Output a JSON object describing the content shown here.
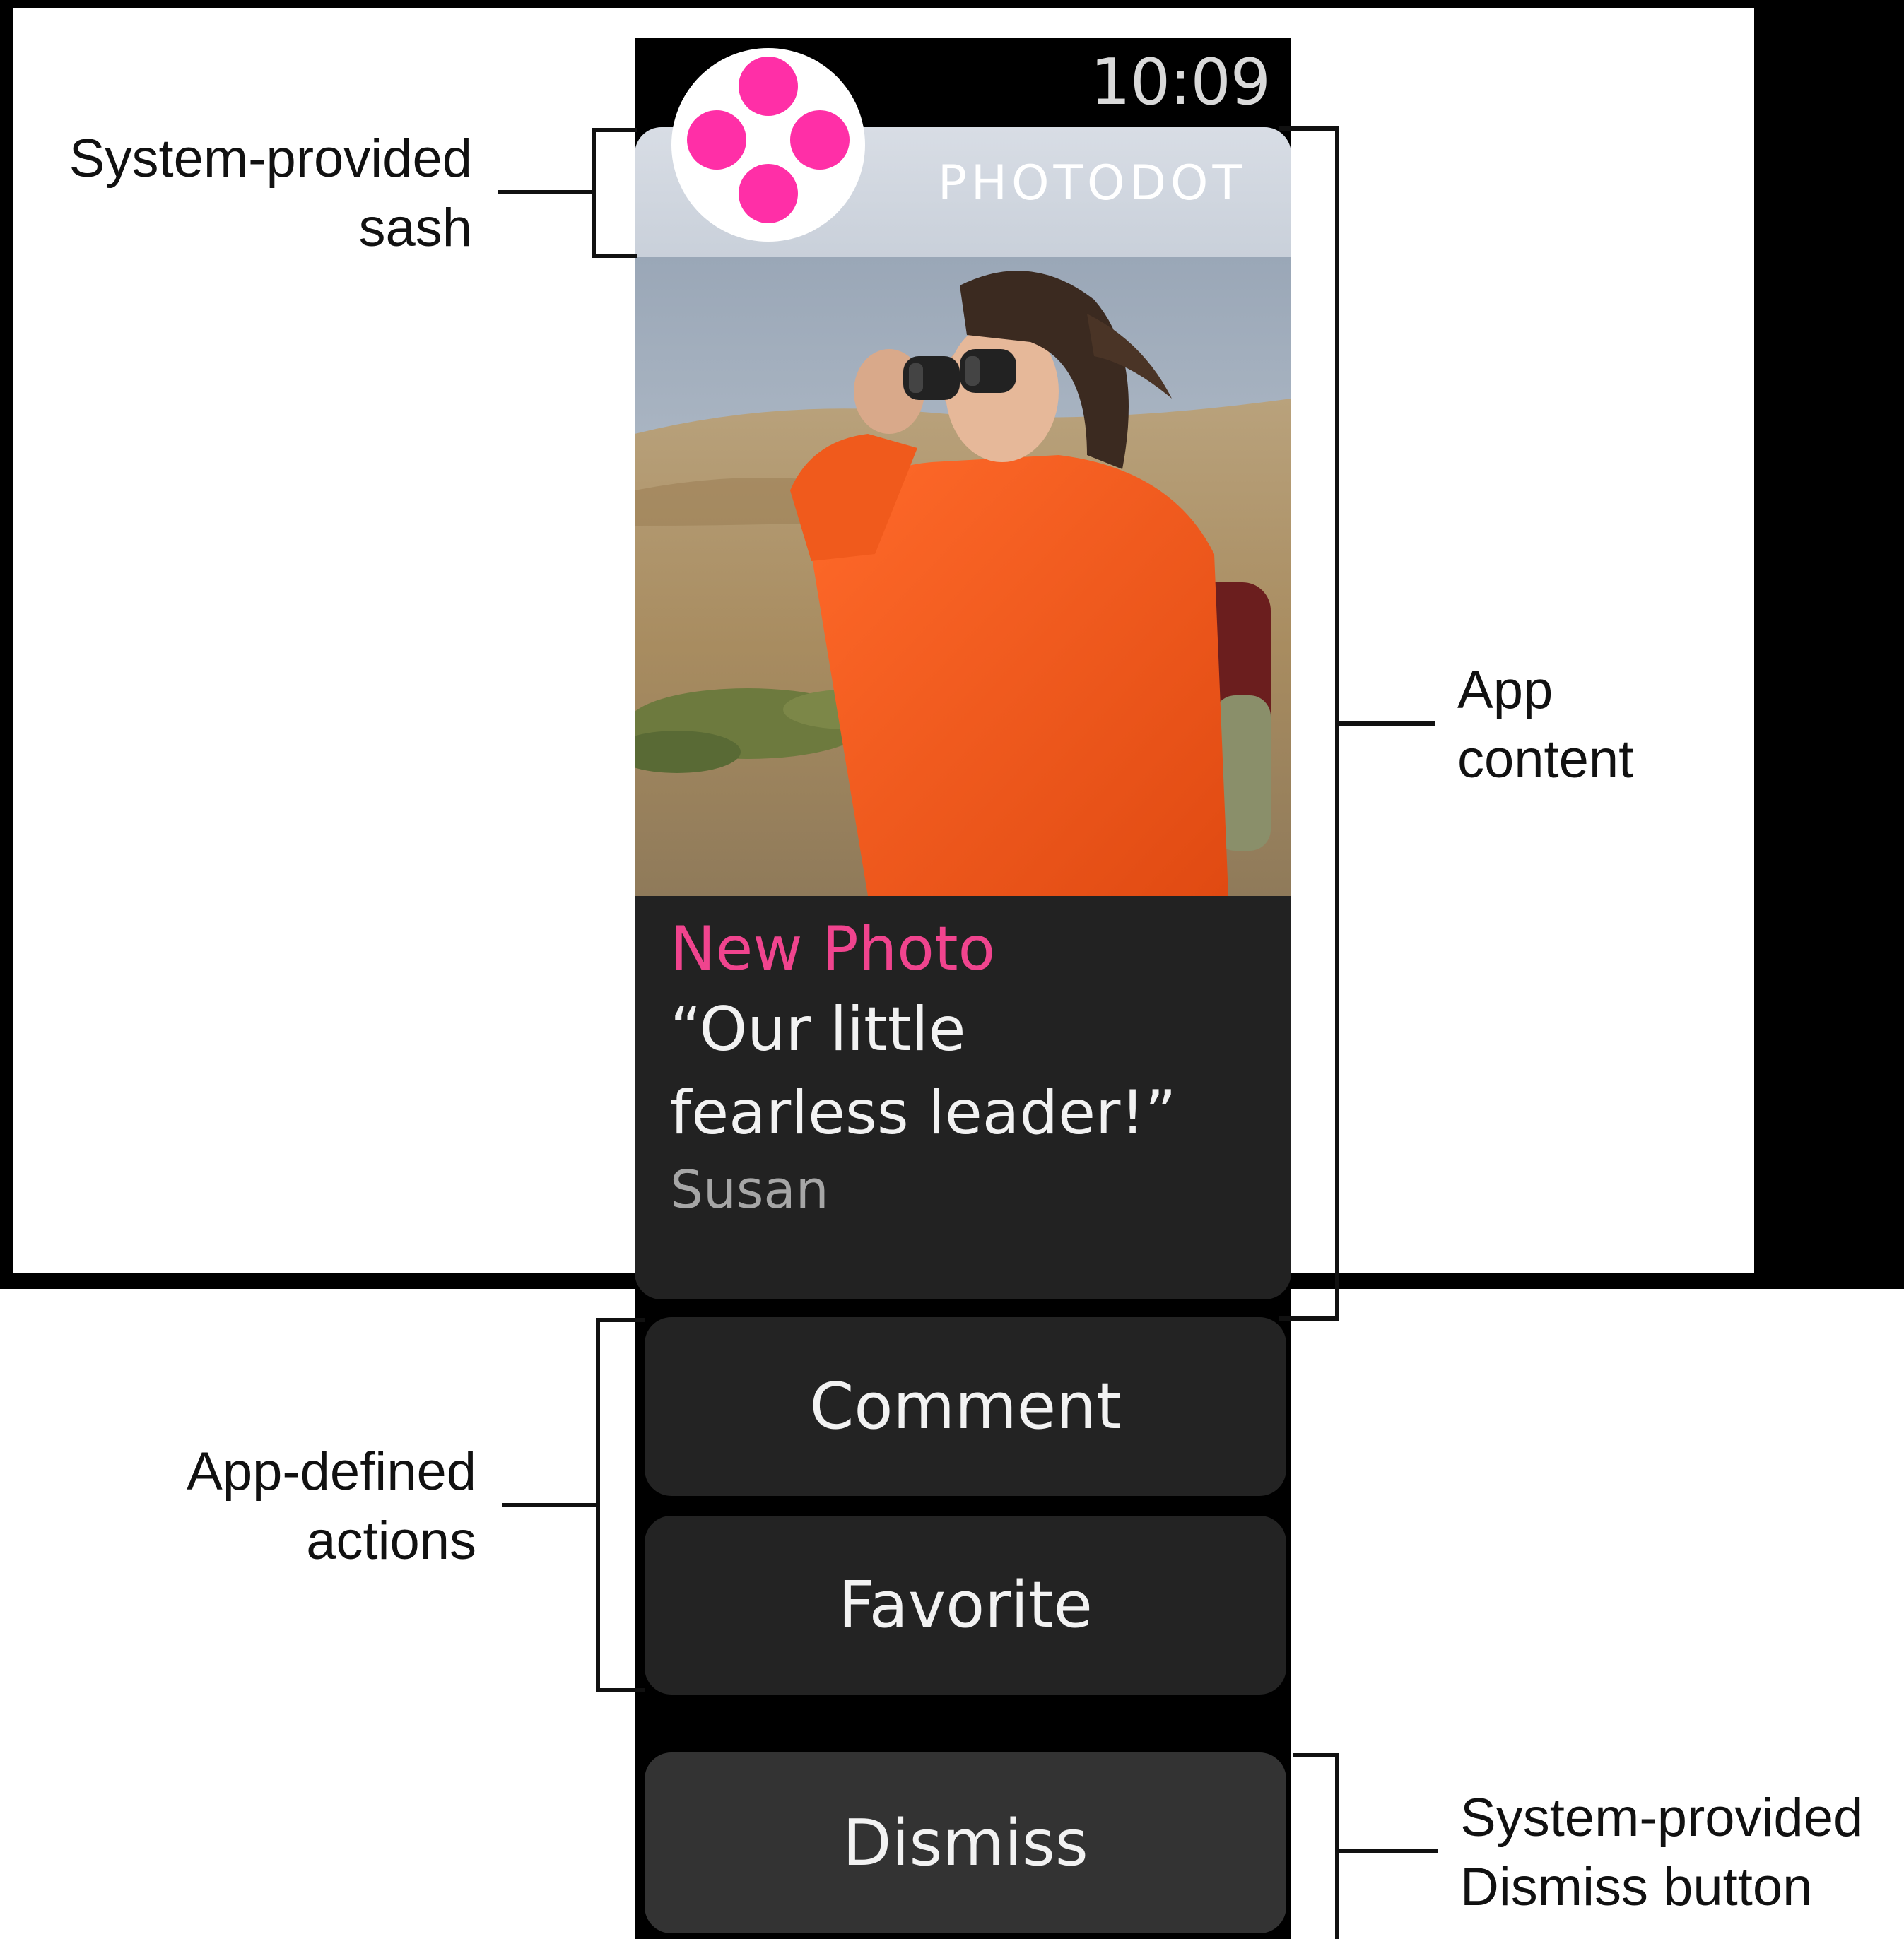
{
  "watch": {
    "time": "10:09",
    "sash_title": "PHOTODOT",
    "notification": {
      "title": "New Photo",
      "body": "“Our little fearless leader!”",
      "sender": "Susan"
    },
    "actions": [
      "Comment",
      "Favorite"
    ],
    "dismiss_label": "Dismiss"
  },
  "callouts": {
    "sash": [
      "System-provided",
      "sash"
    ],
    "app_content": [
      "App",
      "content"
    ],
    "actions": [
      "App-defined",
      "actions"
    ],
    "dismiss": [
      "System-provided",
      "Dismiss button"
    ]
  },
  "colors": {
    "accent_pink": "#f0448e",
    "icon_dots": "#ff2fa7",
    "card_bg": "#222222",
    "button_bg": "#232323",
    "dismiss_bg": "#333333"
  }
}
